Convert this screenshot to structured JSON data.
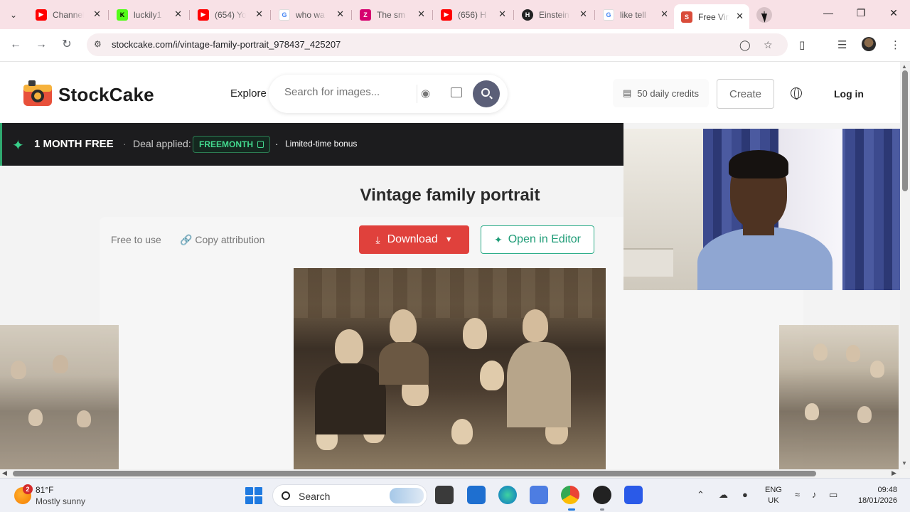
{
  "browser": {
    "tabs": [
      {
        "title": "Channel",
        "favicon": "youtube-icon",
        "color": "#ff0000",
        "active": false
      },
      {
        "title": "luckily1",
        "favicon": "kick-icon",
        "color": "#53fc18",
        "active": false
      },
      {
        "title": "(654) Yo",
        "favicon": "youtube-icon",
        "color": "#ff0000",
        "active": false
      },
      {
        "title": "who wa",
        "favicon": "google-icon",
        "color": "#4285f4",
        "active": false
      },
      {
        "title": "The sm",
        "favicon": "zazzle-icon",
        "color": "#d6006f",
        "active": false
      },
      {
        "title": "(656) H",
        "favicon": "youtube-icon",
        "color": "#ff0000",
        "active": false
      },
      {
        "title": "Einstein",
        "favicon": "hix-icon",
        "color": "#222222",
        "active": false
      },
      {
        "title": "like tell",
        "favicon": "google-icon",
        "color": "#4285f4",
        "active": false
      },
      {
        "title": "Free Vin",
        "favicon": "stockcake-icon",
        "color": "#d94c3a",
        "active": true
      }
    ],
    "url": "stockcake.com/i/vintage-family-portrait_978437_425207"
  },
  "site": {
    "logo_text": "StockCake",
    "explore_label": "Explore",
    "search_placeholder": "Search for images...",
    "credits_label": "50 daily credits",
    "create_label": "Create",
    "login_label": "Log in"
  },
  "promo": {
    "title": "1 MONTH FREE",
    "deal_label": "Deal applied:",
    "code": "FREEMONTH",
    "bonus": "Limited-time bonus",
    "accent": "#38d08a"
  },
  "page": {
    "title": "Vintage family portrait",
    "free_to_use": "Free to use",
    "copy_attribution": "Copy attribution",
    "download_label": "Download",
    "open_editor_label": "Open in Editor",
    "download_color": "#e0413c",
    "editor_color": "#2fae8a"
  },
  "taskbar": {
    "weather_badge": "2",
    "temperature": "81°F",
    "condition": "Mostly sunny",
    "search_label": "Search",
    "language_line1": "ENG",
    "language_line2": "UK",
    "time": "09:48",
    "date": "18/01/2026"
  }
}
